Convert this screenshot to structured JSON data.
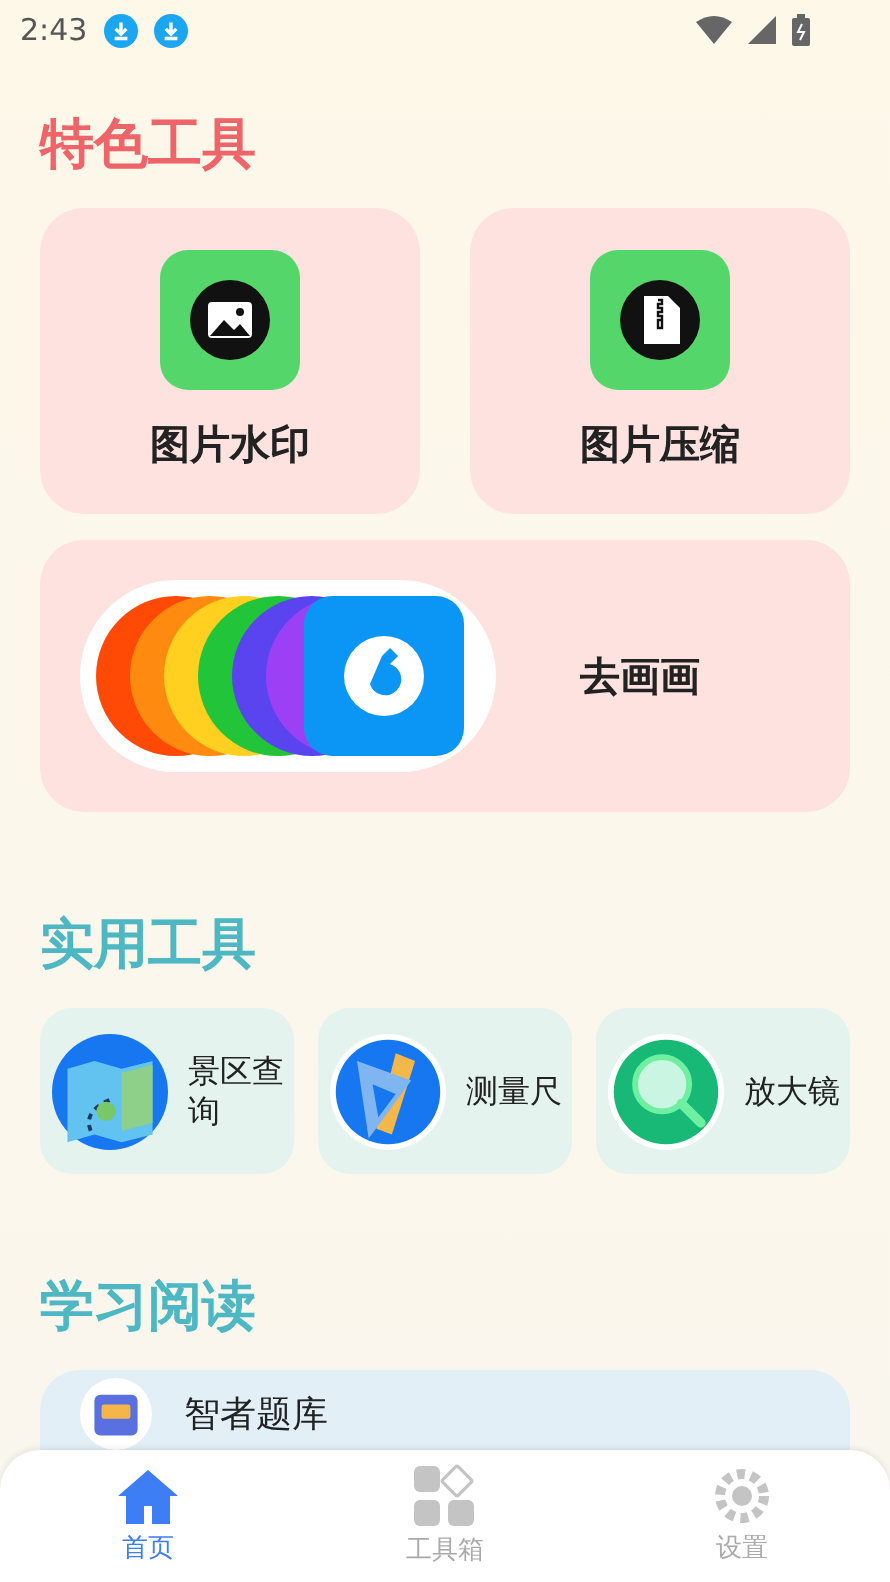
{
  "status_bar": {
    "time": "2:43"
  },
  "featured": {
    "title": "特色工具",
    "tools": [
      {
        "label": "图片水印",
        "kind": "watermark"
      },
      {
        "label": "图片压缩",
        "kind": "compress"
      }
    ],
    "wide_tool": {
      "label": "去画画"
    }
  },
  "utilities": {
    "title": "实用工具",
    "tools": [
      {
        "label": "景区查询",
        "kind": "map"
      },
      {
        "label": "测量尺",
        "kind": "ruler"
      },
      {
        "label": "放大镜",
        "kind": "magnifier"
      }
    ]
  },
  "reading": {
    "title": "学习阅读",
    "items": [
      {
        "label": "智者题库"
      }
    ]
  },
  "bottom_nav": [
    {
      "label": "首页",
      "kind": "home",
      "selected": true
    },
    {
      "label": "工具箱",
      "kind": "toolbox",
      "selected": false
    },
    {
      "label": "设置",
      "kind": "settings",
      "selected": false
    }
  ]
}
